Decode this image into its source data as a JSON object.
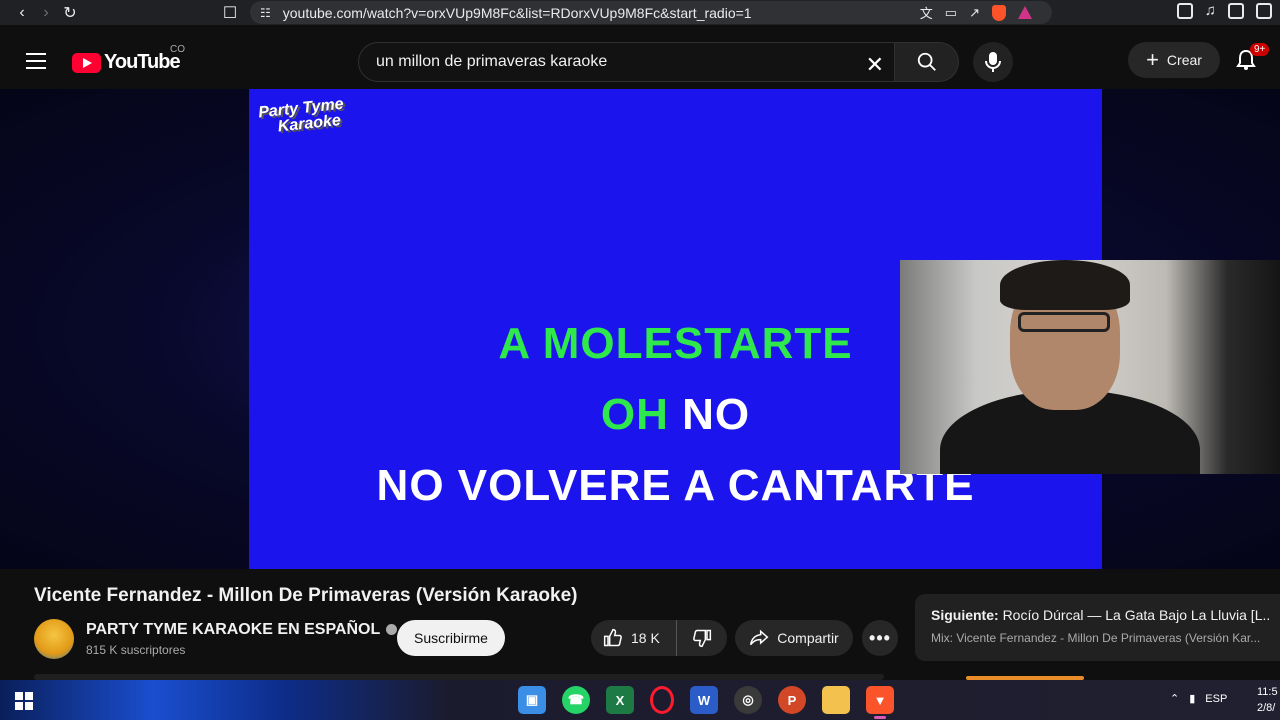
{
  "browser": {
    "url": "youtube.com/watch?v=orxVUp9M8Fc&list=RDorxVUp9M8Fc&start_radio=1"
  },
  "header": {
    "logo_text": "YouTube",
    "country_code": "CO",
    "search_value": "un millon de primaveras karaoke",
    "create_label": "Crear",
    "notification_count": "9+"
  },
  "video": {
    "watermark_line1": "Party Tyme",
    "watermark_line2": "Karaoke",
    "lyric_line1": "A MOLESTARTE",
    "lyric_line2_sung": "OH",
    "lyric_line2_rest": "NO",
    "lyric_line3": "NO VOLVERE A CANTARTE"
  },
  "info": {
    "title": "Vicente Fernandez - Millon De Primaveras (Versión Karaoke)",
    "channel_name": "PARTY TYME KARAOKE EN ESPAÑOL",
    "subscribers": "815 K suscriptores",
    "subscribe_label": "Suscribirme",
    "likes": "18 K",
    "share_label": "Compartir"
  },
  "up_next": {
    "label": "Siguiente:",
    "title": "Rocío Dúrcal — La Gata Bajo La Lluvia [L...",
    "mix": "Mix: Vicente Fernandez - Millon De Primaveras (Versión Kar..."
  },
  "taskbar": {
    "language": "ESP",
    "time": "11:5",
    "date": "2/8/"
  },
  "colors": {
    "video_bg": "#1c14ec",
    "lyric_sung": "#2ee84c",
    "lyric_unsung": "#ffffff",
    "yt_red": "#ff0033"
  }
}
